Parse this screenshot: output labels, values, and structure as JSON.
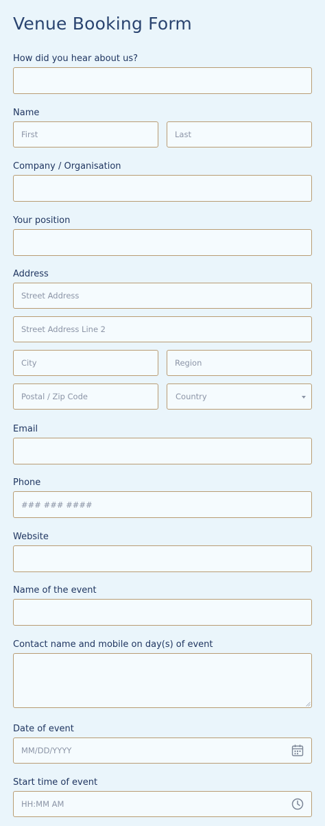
{
  "form": {
    "title": "Venue Booking Form",
    "hear_about": {
      "label": "How did you hear about us?",
      "value": ""
    },
    "name": {
      "label": "Name",
      "first_placeholder": "First",
      "last_placeholder": "Last"
    },
    "company": {
      "label": "Company / Organisation",
      "value": ""
    },
    "position": {
      "label": "Your position",
      "value": ""
    },
    "address": {
      "label": "Address",
      "street_placeholder": "Street Address",
      "street2_placeholder": "Street Address Line 2",
      "city_placeholder": "City",
      "region_placeholder": "Region",
      "postal_placeholder": "Postal / Zip Code",
      "country_selected": "Country"
    },
    "email": {
      "label": "Email",
      "value": ""
    },
    "phone": {
      "label": "Phone",
      "placeholder": "### ### ####"
    },
    "website": {
      "label": "Website",
      "value": ""
    },
    "event_name": {
      "label": "Name of the event",
      "value": ""
    },
    "contact": {
      "label": "Contact name and mobile on day(s) of event",
      "value": ""
    },
    "event_date": {
      "label": "Date of event",
      "placeholder": "MM/DD/YYYY",
      "icon": "calendar-icon"
    },
    "start_time": {
      "label": "Start time of event",
      "placeholder": "HH:MM AM",
      "icon": "clock-icon"
    }
  },
  "colors": {
    "background": "#eaf5fb",
    "field_border": "#b89b72",
    "title": "#2a4470"
  }
}
